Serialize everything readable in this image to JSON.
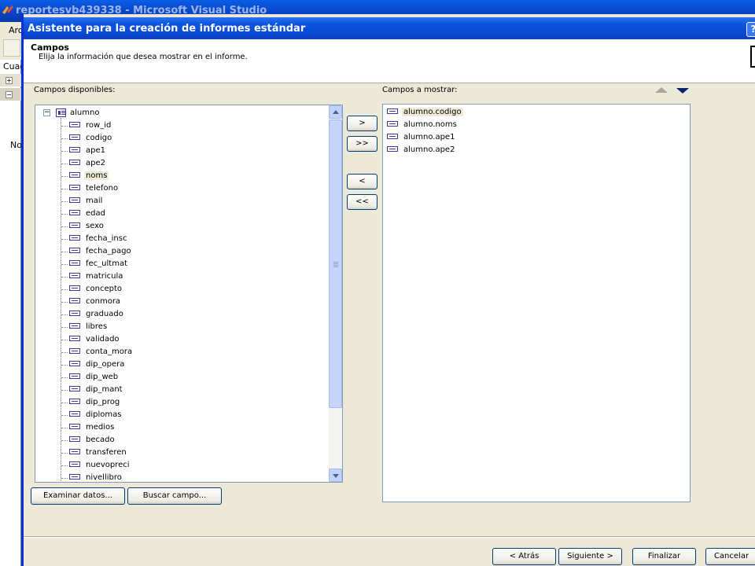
{
  "vs_window": {
    "title": "reportesvb439338 - Microsoft Visual Studio",
    "menu_fragment": "Arc",
    "pane_fragment": "Cuad",
    "row_fragment": "No"
  },
  "dialog": {
    "title": "Asistente para la creación de informes estándar",
    "help_label": "?",
    "section_title": "Campos",
    "section_subtitle": "Elija la información que desea mostrar en el informe."
  },
  "available": {
    "label": "Campos disponibles:",
    "table": "alumno",
    "fields": [
      "row_id",
      "codigo",
      "ape1",
      "ape2",
      "noms",
      "telefono",
      "mail",
      "edad",
      "sexo",
      "fecha_insc",
      "fecha_pago",
      "fec_ultmat",
      "matricula",
      "concepto",
      "conmora",
      "graduado",
      "libres",
      "validado",
      "conta_mora",
      "dip_opera",
      "dip_web",
      "dip_mant",
      "dip_prog",
      "diplomas",
      "medios",
      "becado",
      "transferen",
      "nuevopreci",
      "nivellibro"
    ],
    "selected_field": "noms"
  },
  "display": {
    "label": "Campos a mostrar:",
    "fields": [
      "alumno.codigo",
      "alumno.noms",
      "alumno.ape1",
      "alumno.ape2"
    ],
    "selected_field": "alumno.codigo"
  },
  "move_buttons": {
    "add": ">",
    "add_all": ">>",
    "remove": "<",
    "remove_all": "<<"
  },
  "actions": {
    "browse_data": "Examinar datos...",
    "find_field": "Buscar campo..."
  },
  "footer": {
    "back": "< Atrás",
    "next": "Siguiente >",
    "finish": "Finalizar",
    "cancel": "Cancelar"
  },
  "colors": {
    "title_bar": "#0846d0",
    "dialog_bg": "#ece9d8",
    "list_border": "#7f9db9"
  }
}
